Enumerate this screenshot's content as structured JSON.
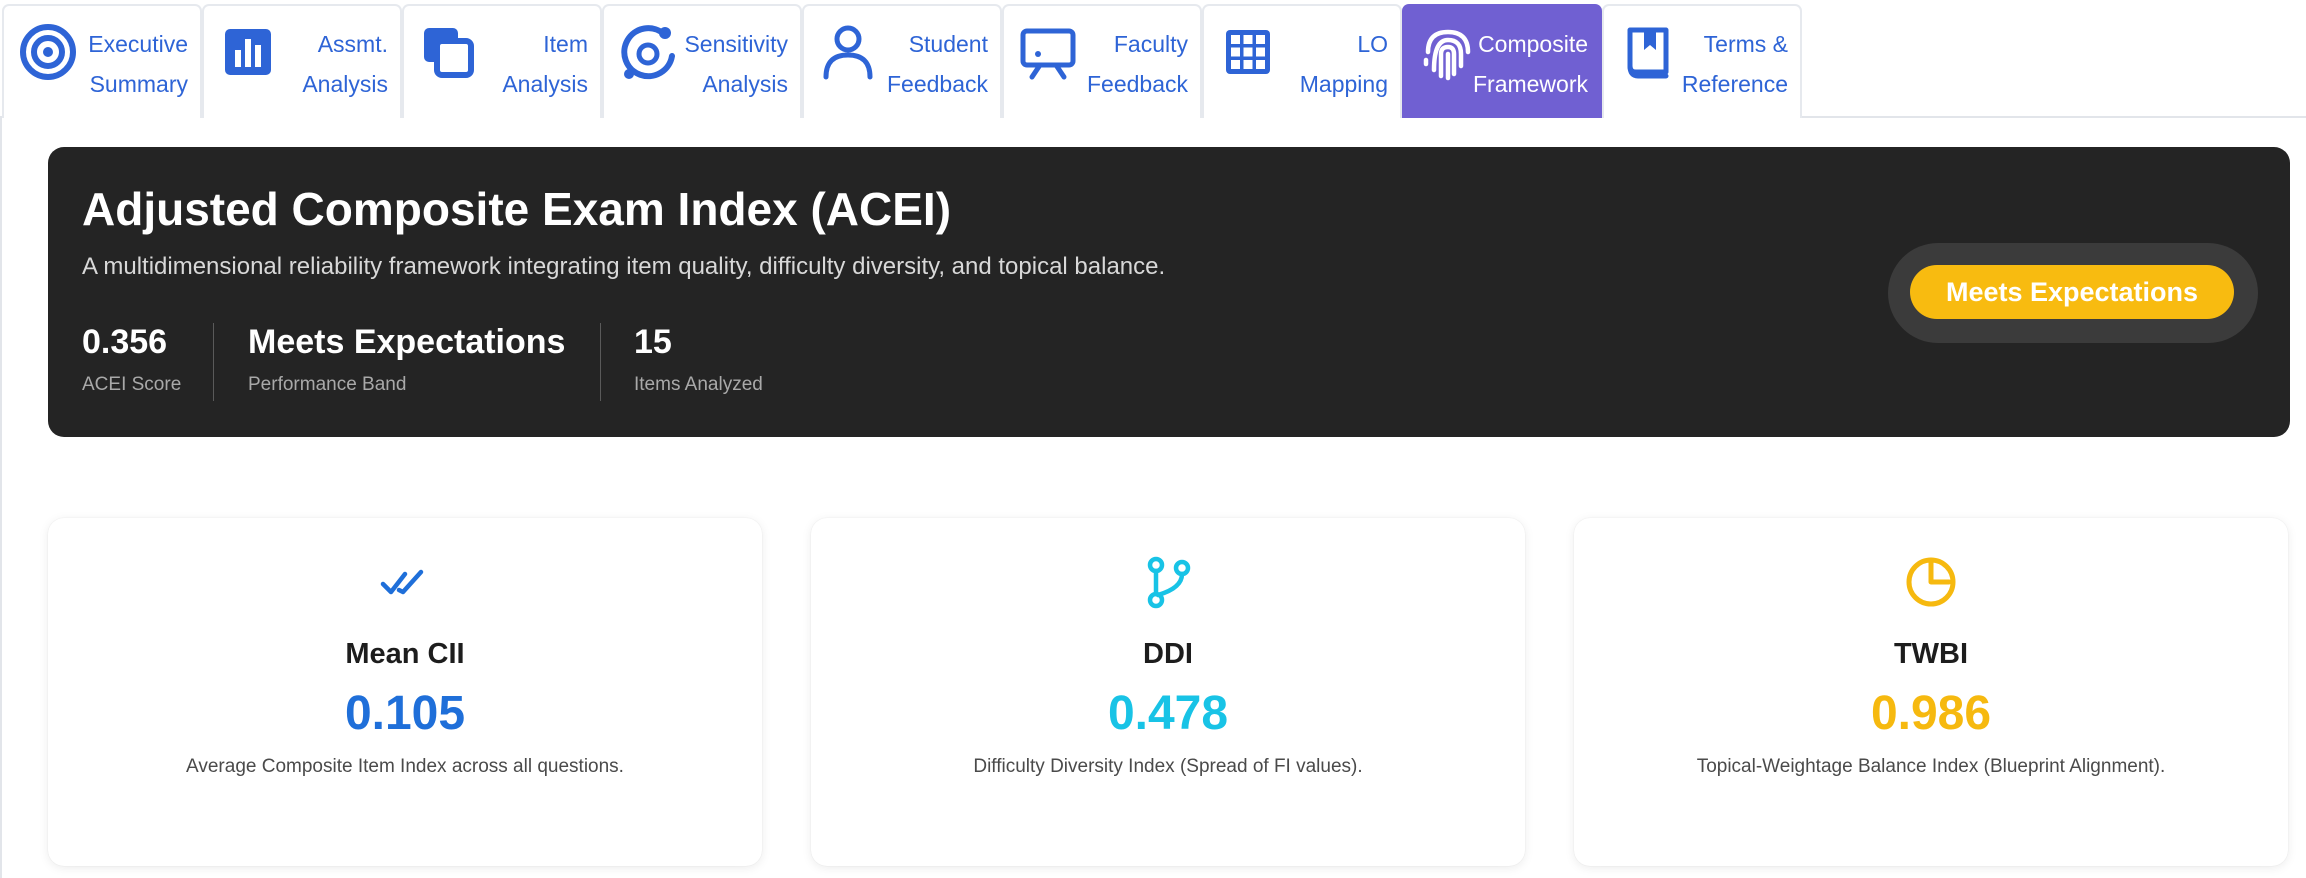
{
  "tabs": [
    {
      "line1": "Executive",
      "line2": "Summary",
      "icon": "target-icon",
      "active": false
    },
    {
      "line1": "Assmt.",
      "line2": "Analysis",
      "icon": "bar-chart-icon",
      "active": false
    },
    {
      "line1": "Item",
      "line2": "Analysis",
      "icon": "stacked-squares-icon",
      "active": false
    },
    {
      "line1": "Sensitivity",
      "line2": "Analysis",
      "icon": "orbit-icon",
      "active": false
    },
    {
      "line1": "Student",
      "line2": "Feedback",
      "icon": "person-icon",
      "active": false
    },
    {
      "line1": "Faculty",
      "line2": "Feedback",
      "icon": "presentation-board-icon",
      "active": false
    },
    {
      "line1": "LO",
      "line2": "Mapping",
      "icon": "grid-icon",
      "active": false
    },
    {
      "line1": "Composite",
      "line2": "Framework",
      "icon": "fingerprint-icon",
      "active": true
    },
    {
      "line1": "Terms &",
      "line2": "Reference",
      "icon": "bookmark-book-icon",
      "active": false
    }
  ],
  "hero": {
    "title": "Adjusted Composite Exam Index (ACEI)",
    "subtitle": "A multidimensional reliability framework integrating item quality, difficulty diversity, and topical balance.",
    "stats": [
      {
        "value": "0.356",
        "label": "ACEI Score"
      },
      {
        "value": "Meets Expectations",
        "label": "Performance Band"
      },
      {
        "value": "15",
        "label": "Items Analyzed"
      }
    ],
    "badge": "Meets Expectations"
  },
  "cards": [
    {
      "title": "Mean CII",
      "value": "0.105",
      "description": "Average Composite Item Index across all questions.",
      "icon": "double-check-icon",
      "color": "#1f6fd9"
    },
    {
      "title": "DDI",
      "value": "0.478",
      "description": "Difficulty Diversity Index (Spread of FI values).",
      "icon": "branch-icon",
      "color": "#18c3e6"
    },
    {
      "title": "TWBI",
      "value": "0.986",
      "description": "Topical-Weightage Balance Index (Blueprint Alignment).",
      "icon": "pie-chart-icon",
      "color": "#f6b90f"
    }
  ],
  "colors": {
    "accent": "#7060d2",
    "tab_text": "#2e64d6",
    "hero_bg": "#242424",
    "badge_bg": "#f8bb10"
  }
}
